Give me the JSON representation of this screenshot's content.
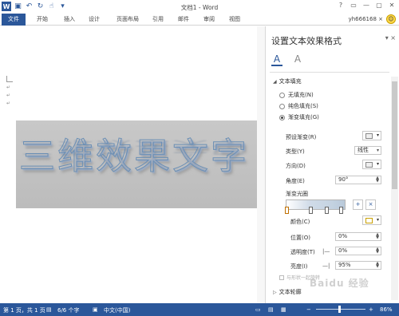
{
  "window": {
    "title": "文档1 - Word",
    "controls": [
      "?",
      "▭",
      "—",
      "▢",
      "✕"
    ]
  },
  "ribbon": {
    "file_tab": "文件",
    "tabs": [
      "开始",
      "插入",
      "设计",
      "页面布局",
      "引用",
      "邮件",
      "审阅",
      "视图"
    ],
    "user": "yh666168 ×"
  },
  "document": {
    "effect_text": "三维效果文字",
    "paragraph_mark": "↵"
  },
  "pane": {
    "title": "设置文本效果格式",
    "close": "▾ ×",
    "icon_fill": "A",
    "icon_effects": "A",
    "section_fill": "文本填充",
    "fill_options": [
      {
        "label": "无填充(N)",
        "selected": false
      },
      {
        "label": "纯色填充(S)",
        "selected": false
      },
      {
        "label": "渐变填充(G)",
        "selected": true
      }
    ],
    "preset_label": "预设渐变(R)",
    "type_label": "类型(Y)",
    "type_value": "线性",
    "direction_label": "方向(D)",
    "angle_label": "角度(E)",
    "angle_value": "90°",
    "stops_label": "渐变光圈",
    "color_label": "颜色(C)",
    "position_label": "位置(O)",
    "position_value": "0%",
    "transparency_label": "透明度(T)",
    "transparency_value": "0%",
    "brightness_label": "亮度(I)",
    "brightness_value": "95%",
    "rotate_label": "与形状一起旋转",
    "section_outline": "文本轮廓"
  },
  "statusbar": {
    "page": "第 1 页，共 1 页",
    "words": "6/6 个字",
    "lang": "中文(中国)",
    "zoom": "86%",
    "zoom_level": 0.5
  },
  "watermark": "Baidu 经验",
  "colors": {
    "accent": "#2b579a",
    "effect_stroke": "#6b8fb5"
  }
}
